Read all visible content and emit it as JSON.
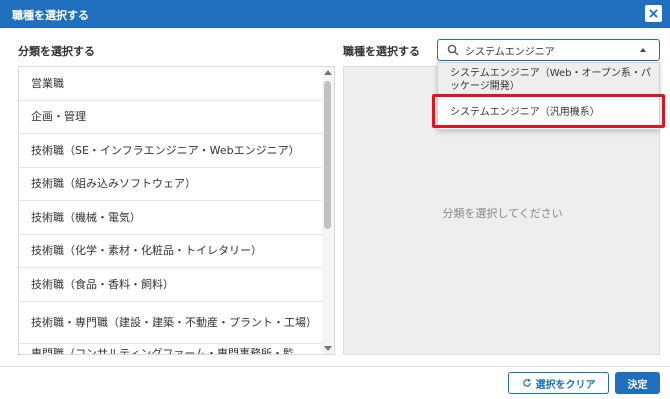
{
  "dialog": {
    "title": "職種を選択する"
  },
  "left": {
    "label": "分類を選択する",
    "items": [
      "営業職",
      "企画・管理",
      "技術職（SE・インフラエンジニア・Webエンジニア）",
      "技術職（組み込みソフトウェア）",
      "技術職（機械・電気）",
      "技術職（化学・素材・化粧品・トイレタリー）",
      "技術職（食品・香料・飼料）",
      "技術職・専門職（建設・建築・不動産・プラント・工場）",
      "専門職（コンサルティングファーム・専門事務所・監"
    ]
  },
  "right": {
    "label": "職種を選択する",
    "empty_message": "分類を選択してください",
    "search_value": "システムエンジニア",
    "options": [
      "システムエンジニア（Web・オープン系・パッケージ開発）",
      "システムエンジニア（汎用機系）"
    ]
  },
  "footer": {
    "clear_label": "選択をクリア",
    "submit_label": "決定"
  },
  "colors": {
    "brand": "#1f6fbd",
    "highlight": "#e0141e"
  }
}
